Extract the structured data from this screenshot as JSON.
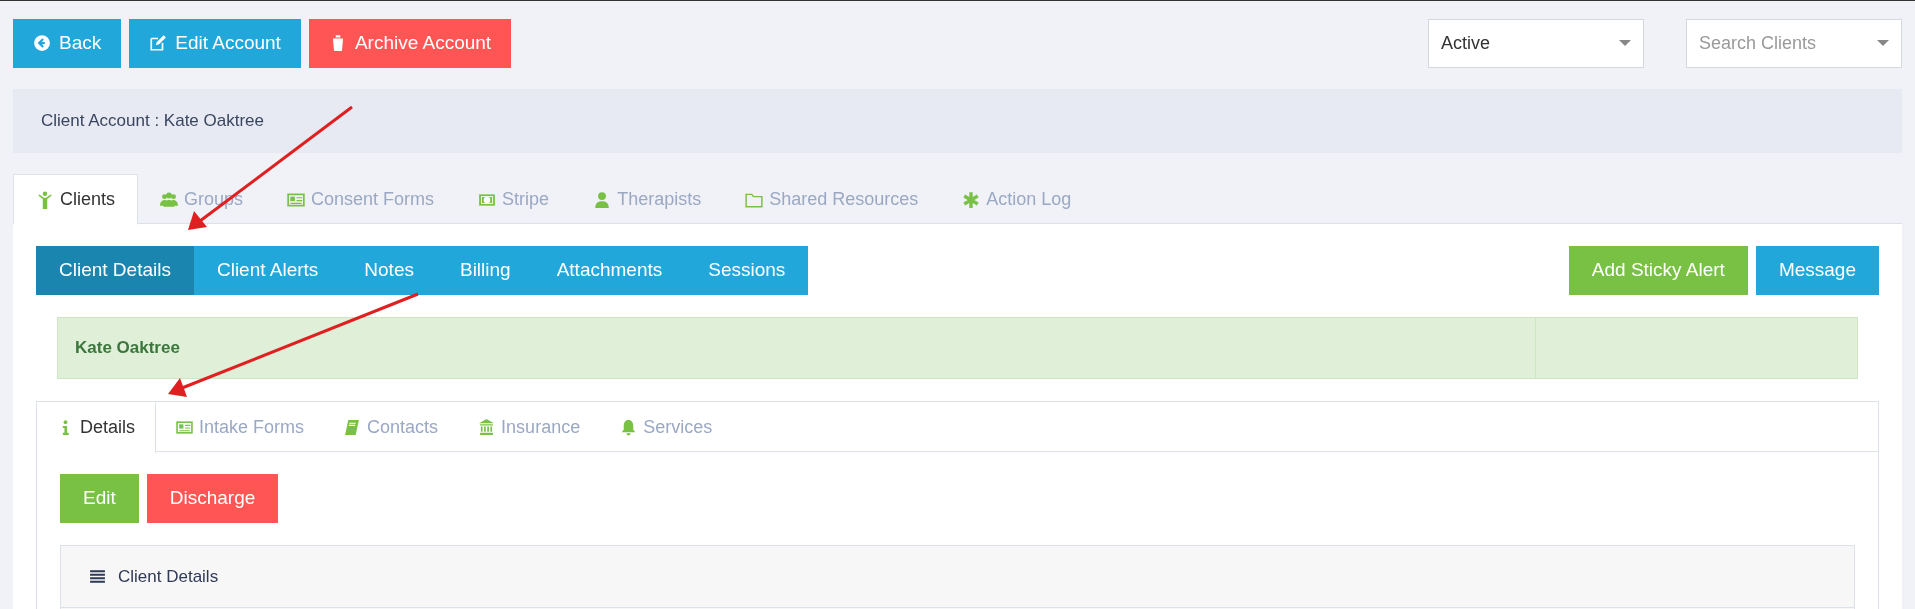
{
  "toolbar": {
    "buttons": [
      {
        "kind": "info",
        "label": "Back"
      },
      {
        "kind": "info",
        "label": "Edit Account"
      },
      {
        "kind": "danger",
        "label": "Archive Account"
      }
    ],
    "status_select": {
      "value": "Active"
    },
    "search_select": {
      "placeholder": "Search Clients"
    }
  },
  "account_title": "Client Account : Kate Oaktree",
  "main_tabs": [
    {
      "label": "Clients",
      "selected": true
    },
    {
      "label": "Groups",
      "selected": false
    },
    {
      "label": "Consent Forms",
      "selected": false
    },
    {
      "label": "Stripe",
      "selected": false
    },
    {
      "label": "Therapists",
      "selected": false
    },
    {
      "label": "Shared Resources",
      "selected": false
    },
    {
      "label": "Action Log",
      "selected": false
    }
  ],
  "sub_nav": [
    {
      "label": "Client Details",
      "selected": true
    },
    {
      "label": "Client Alerts",
      "selected": false
    },
    {
      "label": "Notes",
      "selected": false
    },
    {
      "label": "Billing",
      "selected": false
    },
    {
      "label": "Attachments",
      "selected": false
    },
    {
      "label": "Sessions",
      "selected": false
    }
  ],
  "actions": [
    {
      "kind": "success",
      "label": "Add Sticky Alert"
    },
    {
      "kind": "info",
      "label": "Message"
    }
  ],
  "client_banner": {
    "name": "Kate Oaktree"
  },
  "detail_tabs": [
    {
      "label": "Details",
      "selected": true
    },
    {
      "label": "Intake Forms",
      "selected": false
    },
    {
      "label": "Contacts",
      "selected": false
    },
    {
      "label": "Insurance",
      "selected": false
    },
    {
      "label": "Services",
      "selected": false
    }
  ],
  "detail_buttons": [
    {
      "kind": "success",
      "label": "Edit"
    },
    {
      "kind": "danger",
      "label": "Discharge"
    }
  ],
  "details_panel": {
    "title": "Client Details"
  }
}
